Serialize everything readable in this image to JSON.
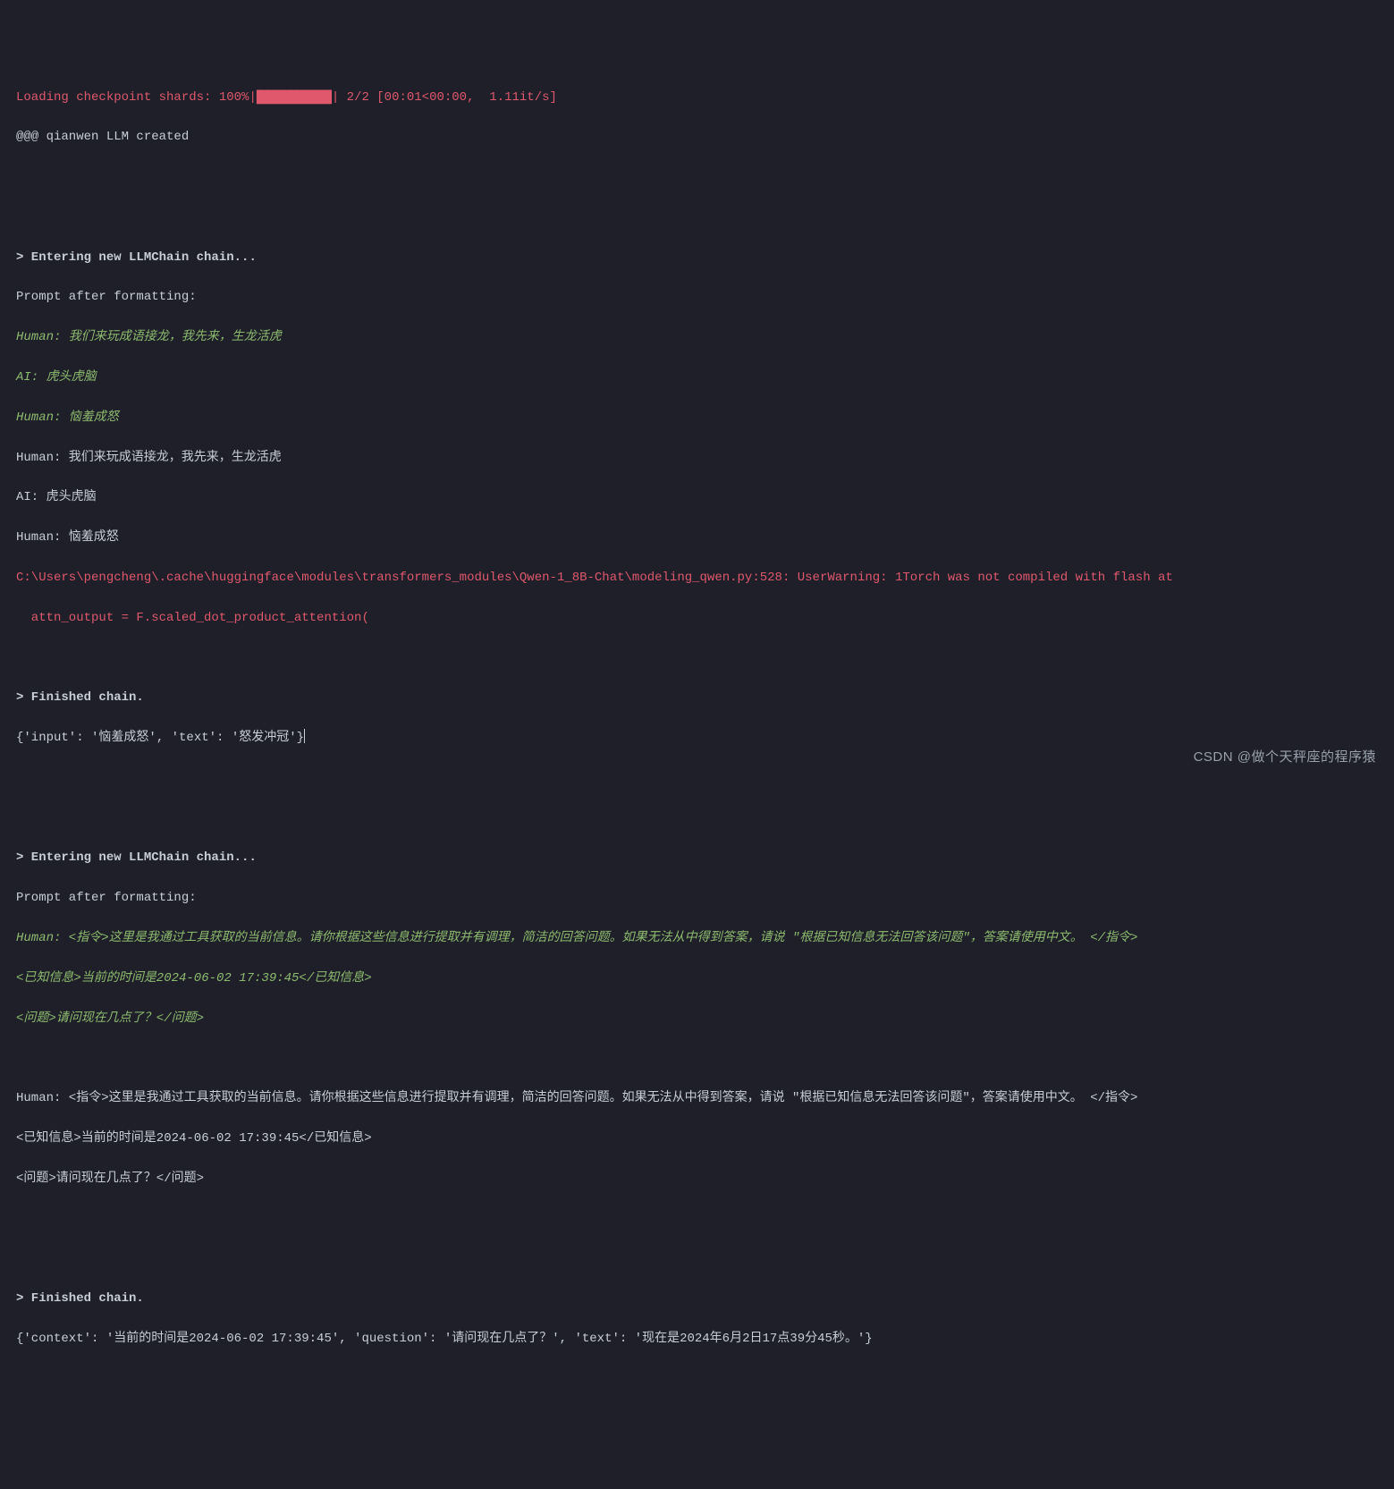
{
  "progress": {
    "label": "Loading checkpoint shards: 100%|",
    "bar": "██████████",
    "stats": "| 2/2 [00:01<00:00,  1.11it/s]"
  },
  "created": "@@@ qianwen LLM created",
  "chain1": {
    "enter": "> Entering new LLMChain chain...",
    "prompt_after": "Prompt after formatting:",
    "fmt_human1": "Human: 我们来玩成语接龙，我先来，生龙活虎",
    "fmt_ai": "AI: 虎头虎脑",
    "fmt_human2": "Human: 恼羞成怒",
    "human1": "Human: 我们来玩成语接龙，我先来，生龙活虎",
    "ai": "AI: 虎头虎脑",
    "human2": "Human: 恼羞成怒",
    "warn1": "C:\\Users\\pengcheng\\.cache\\huggingface\\modules\\transformers_modules\\Qwen-1_8B-Chat\\modeling_qwen.py:528: UserWarning: 1Torch was not compiled with flash at",
    "warn2": "  attn_output = F.scaled_dot_product_attention(",
    "finished": "> Finished chain.",
    "result": "{'input': '恼羞成怒', 'text': '怒发冲冠'}"
  },
  "chain2": {
    "enter": "> Entering new LLMChain chain...",
    "prompt_after": "Prompt after formatting:",
    "fmt_human_l1": "Human: <指令>这里是我通过工具获取的当前信息。请你根据这些信息进行提取并有调理，简洁的回答问题。如果无法从中得到答案，请说 \"根据已知信息无法回答该问题\"，答案请使用中文。 </指令>",
    "fmt_human_l2": "<已知信息>当前的时间是2024-06-02 17:39:45</已知信息>",
    "fmt_human_l3": "<问题>请问现在几点了？</问题>",
    "human_l1": "Human: <指令>这里是我通过工具获取的当前信息。请你根据这些信息进行提取并有调理，简洁的回答问题。如果无法从中得到答案，请说 \"根据已知信息无法回答该问题\"，答案请使用中文。 </指令>",
    "human_l2": "<已知信息>当前的时间是2024-06-02 17:39:45</已知信息>",
    "human_l3": "<问题>请问现在几点了？</问题>",
    "finished": "> Finished chain.",
    "result": "{'context': '当前的时间是2024-06-02 17:39:45', 'question': '请问现在几点了？', 'text': '现在是2024年6月2日17点39分45秒。'}"
  },
  "watermark": "CSDN @做个天秤座的程序猿"
}
